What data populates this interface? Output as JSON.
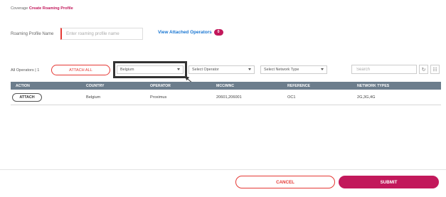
{
  "breadcrumb": {
    "parent": "Coverage",
    "current": "Create Roaming Profile"
  },
  "form": {
    "name_label": "Roaming Profile Name",
    "name_placeholder": "Enter roaming profile name",
    "name_value": ""
  },
  "view_attached": {
    "label": "View Attached Operators",
    "count": "0"
  },
  "toolbar": {
    "all_operators_label": "All Operators",
    "separator": "|",
    "all_operators_count": "1",
    "attach_all_label": "ATTACH ALL",
    "country_select": "Belgium",
    "operator_select": "Select Operator",
    "network_select": "Select Network Type",
    "search_placeholder": "Search",
    "icons": [
      "refresh-icon",
      "grid-view-icon"
    ]
  },
  "table": {
    "columns": [
      "ACTION",
      "COUNTRY",
      "OPERATOR",
      "MCC/MNC",
      "REFERENCE",
      "NETWORK TYPES"
    ],
    "rows": [
      {
        "action": "ATTACH",
        "country": "Belgium",
        "operator": "Proximus",
        "mcc_mnc": "20601,206001",
        "reference": "OC1",
        "network_types": "2G,3G,4G"
      }
    ]
  },
  "footer": {
    "cancel_label": "CANCEL",
    "submit_label": "SUBMIT"
  },
  "colors": {
    "accent": "#c2185b",
    "red": "#e53935",
    "link": "#1976d2",
    "table_header": "#6c7d8c"
  }
}
